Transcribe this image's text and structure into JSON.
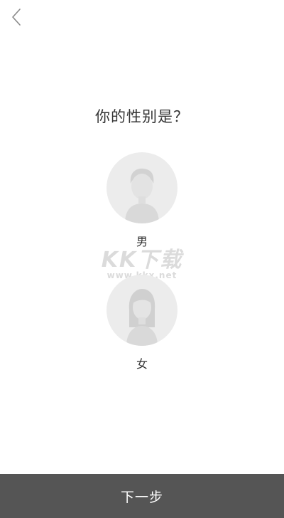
{
  "header": {
    "back_icon": "chevron-left-icon"
  },
  "question": "你的性别是？",
  "options": [
    {
      "label": "男",
      "icon": "male-avatar-icon"
    },
    {
      "label": "女",
      "icon": "female-avatar-icon"
    }
  ],
  "watermark": {
    "title": "KK下载",
    "url": "www.kkx.net"
  },
  "footer": {
    "next_label": "下一步"
  },
  "colors": {
    "avatar_bg": "#ececec",
    "silhouette": "#dadada",
    "footer_bg": "#555555",
    "text": "#333333"
  }
}
